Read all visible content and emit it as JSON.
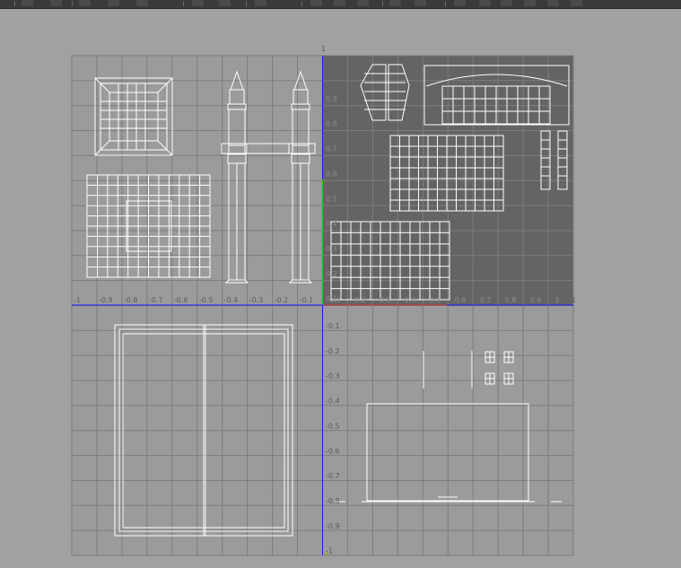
{
  "toolbar": {
    "buttons": [
      "uv-snap-icon",
      "uv-move-icon",
      "uv-layout-icon",
      "uv-flip-u-icon",
      "uv-flip-v-icon",
      "uv-unfold-icon",
      "uv-align-icon",
      "uv-image-icon",
      "uv-checker-icon",
      "uv-shaded-icon",
      "uv-color-icon",
      "uv-ramp-icon",
      "uv-render-icon",
      "uv-texture-icon",
      "uv-border-icon",
      "uv-dim-icon",
      "uv-grid-icon",
      "uv-pixel-snap-icon",
      "uv-highlight-icon"
    ]
  },
  "uv_editor": {
    "colors": {
      "background": "#a1a1a1",
      "grid_area": "#9a9a9a",
      "grid_line": "#7c7c7c",
      "texture_tile": "#636363",
      "u_axis": "#1a1aff",
      "v_axis_top": "#1a1aff",
      "v_axis_green": "#20c020",
      "u_axis_red": "#d03030",
      "wireframe": "#ffffff"
    },
    "axis_ticks": {
      "u_negative": [
        "-1",
        "-0.9",
        "-0.8",
        "-0.7",
        "-0.6",
        "-0.5",
        "-0.4",
        "-0.3",
        "-0.2",
        "-0.1"
      ],
      "u_positive": [
        "0.1",
        "0.2",
        "0.3",
        "0.4",
        "0.5",
        "0.6",
        "0.7",
        "0.8",
        "0.9",
        "1"
      ],
      "v_positive": [
        "1",
        "0.9",
        "0.8",
        "0.7",
        "0.6",
        "0.5",
        "0.4",
        "0.3",
        "0.2",
        "0.1"
      ],
      "v_negative": [
        "-0.1",
        "-0.2",
        "-0.3",
        "-0.4",
        "-0.5",
        "-0.6",
        "-0.7",
        "-0.8",
        "-0.9",
        "-1"
      ]
    },
    "uv_shells": [
      "roof-frame-shell",
      "grid-panel-shell",
      "left-spire-pillar-shell",
      "right-spire-pillar-shell",
      "crossbeam-shell",
      "hexagon-dome-shell",
      "arched-beam-shell",
      "window-panel-shell",
      "small-pillars-shell",
      "lower-window-shell",
      "large-door-frame-shell",
      "base-wall-shell",
      "small-square-shell"
    ]
  }
}
